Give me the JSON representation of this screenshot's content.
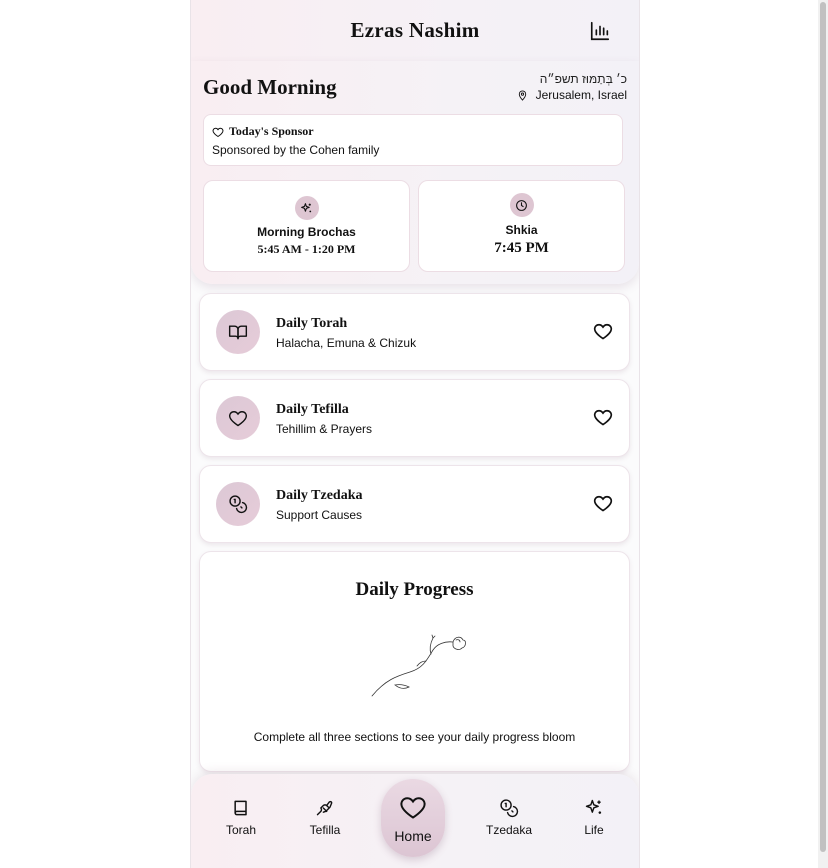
{
  "header": {
    "title": "Ezras Nashim",
    "stats_icon": "bar-chart-icon"
  },
  "hero": {
    "greeting": "Good Morning",
    "hebrew_date": "כ׳ בְּתַמּוּז תשפ״ה",
    "location": "Jerusalem, Israel",
    "location_icon": "map-pin-icon"
  },
  "sponsor": {
    "heading": "Today's Sponsor",
    "text": "Sponsored by the Cohen family",
    "icon": "heart-icon"
  },
  "times": [
    {
      "label": "Morning Brochas",
      "value": "5:45 AM - 1:20 PM",
      "icon": "sparkles-icon"
    },
    {
      "label": "Shkia",
      "value": "7:45 PM",
      "icon": "clock-icon"
    }
  ],
  "features": [
    {
      "title": "Daily Torah",
      "subtitle": "Halacha, Emuna & Chizuk",
      "icon": "book-open-icon"
    },
    {
      "title": "Daily Tefilla",
      "subtitle": "Tehillim & Prayers",
      "icon": "heart-icon"
    },
    {
      "title": "Daily Tzedaka",
      "subtitle": "Support Causes",
      "icon": "coins-icon"
    }
  ],
  "progress": {
    "title": "Daily Progress",
    "description": "Complete all three sections to see your daily progress bloom"
  },
  "nav": {
    "items": [
      {
        "label": "Torah",
        "icon": "book-icon"
      },
      {
        "label": "Tefilla",
        "icon": "praying-hands-icon"
      },
      {
        "label": "Home",
        "icon": "heart-icon"
      },
      {
        "label": "Tzedaka",
        "icon": "coins-icon"
      },
      {
        "label": "Life",
        "icon": "sparkles-icon"
      }
    ],
    "active": "Home"
  },
  "colors": {
    "accent": "#dcc5d3",
    "icon_circle": "#dec6d2",
    "card_border": "#ecdde4",
    "header_bg": "#f9eef2"
  }
}
